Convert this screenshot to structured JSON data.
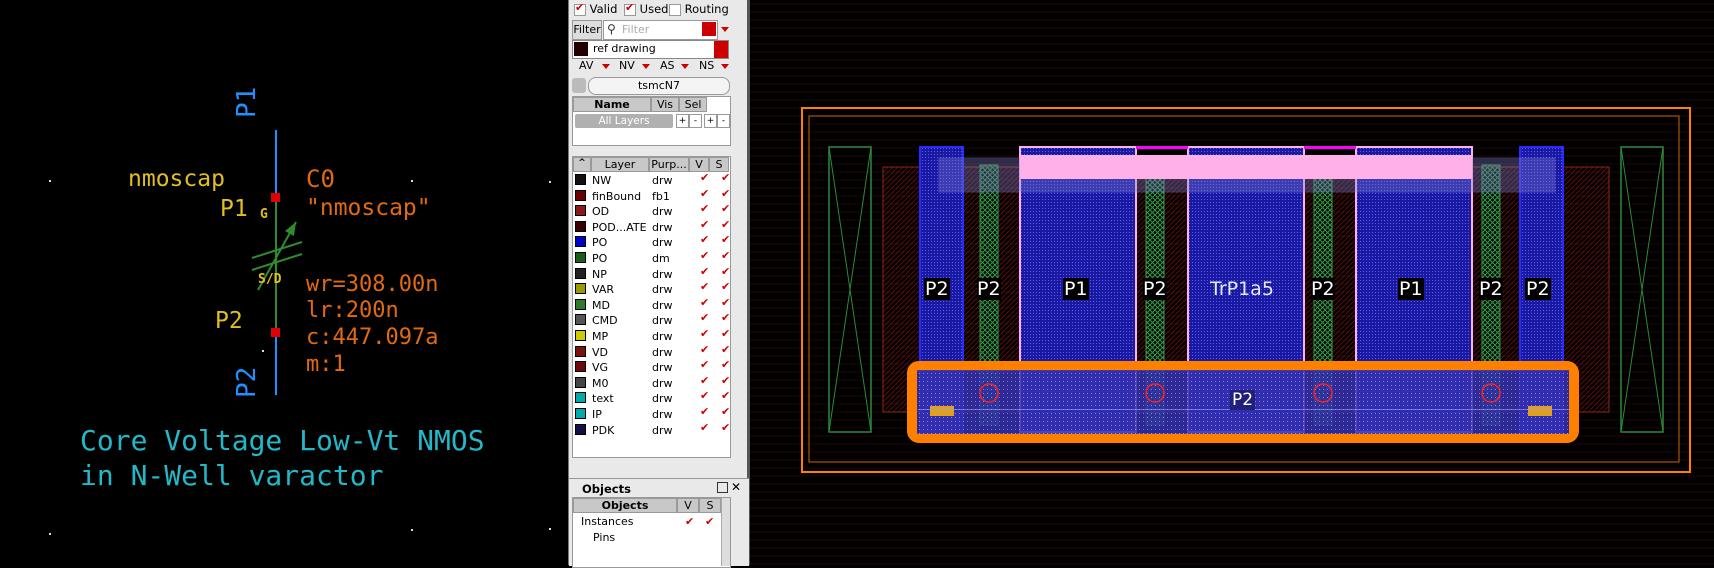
{
  "schematic": {
    "pin_top": "P1",
    "pin_bottom": "P2",
    "cell_name": "nmoscap",
    "inst_name": "C0",
    "cell_quoted": "\"nmoscap\"",
    "net_p1": "P1",
    "net_p2": "P2",
    "gate_label": "G",
    "sd_label": "S/D",
    "params": [
      "wr=308.00n",
      "lr:200n",
      "c:447.097a",
      "m:1"
    ],
    "desc_line1": "Core Voltage Low-Vt NMOS",
    "desc_line2": "in N-Well varactor"
  },
  "panel": {
    "filters": [
      {
        "label": "Valid",
        "checked": true
      },
      {
        "label": "Used",
        "checked": true
      },
      {
        "label": "Routing",
        "checked": false
      }
    ],
    "filter_button": "Filter",
    "filter_placeholder": "Filter",
    "ref_drawing": "ref drawing",
    "toggles": [
      "AV",
      "NV",
      "AS",
      "NS"
    ],
    "tech_lib": "tsmcN7",
    "lpp_headers": {
      "name": "Name",
      "vis": "Vis",
      "sel": "Sel"
    },
    "all_layers": "All Layers",
    "all_layer_buttons": [
      "+",
      "-",
      "+",
      "-"
    ],
    "layer_headers": {
      "layer": "Layer",
      "purpose": "Purp...",
      "v": "V",
      "s": "S"
    },
    "layers": [
      {
        "name": "NW",
        "purpose": "drw",
        "color": "#111111",
        "v": true,
        "s": true
      },
      {
        "name": "finBound",
        "purpose": "fb1",
        "color": "#6b0000",
        "v": true,
        "s": true
      },
      {
        "name": "OD",
        "purpose": "drw",
        "color": "#8b1a1a",
        "v": true,
        "s": true
      },
      {
        "name": "POD...ATE",
        "purpose": "drw",
        "color": "#3a0000",
        "v": true,
        "s": true
      },
      {
        "name": "PO",
        "purpose": "drw",
        "color": "#0000cc",
        "v": true,
        "s": true
      },
      {
        "name": "PO",
        "purpose": "dm",
        "color": "#1a5c1a",
        "v": true,
        "s": true
      },
      {
        "name": "NP",
        "purpose": "drw",
        "color": "#222222",
        "v": true,
        "s": true
      },
      {
        "name": "VAR",
        "purpose": "drw",
        "color": "#999900",
        "v": true,
        "s": true
      },
      {
        "name": "MD",
        "purpose": "drw",
        "color": "#2d7a2d",
        "v": true,
        "s": true
      },
      {
        "name": "CMD",
        "purpose": "drw",
        "color": "#555555",
        "v": true,
        "s": true
      },
      {
        "name": "MP",
        "purpose": "drw",
        "color": "#cccc00",
        "v": true,
        "s": true
      },
      {
        "name": "VD",
        "purpose": "drw",
        "color": "#7a1010",
        "v": true,
        "s": true
      },
      {
        "name": "VG",
        "purpose": "drw",
        "color": "#6a0a0a",
        "v": true,
        "s": true
      },
      {
        "name": "M0",
        "purpose": "drw",
        "color": "#444444",
        "v": true,
        "s": true
      },
      {
        "name": "text",
        "purpose": "drw",
        "color": "#00aaaa",
        "v": true,
        "s": true
      },
      {
        "name": "IP",
        "purpose": "drw",
        "color": "#00aaaa",
        "v": true,
        "s": true
      },
      {
        "name": "PDK",
        "purpose": "drw",
        "color": "#111144",
        "v": true,
        "s": true
      }
    ],
    "objects_title": "Objects",
    "objects_headers": {
      "objects": "Objects",
      "v": "V",
      "s": "S"
    },
    "objects_rows": [
      {
        "name": "Instances",
        "v": true,
        "s": true
      },
      {
        "name": "Pins",
        "v": true,
        "s": true
      }
    ]
  },
  "layout": {
    "labels_p2": "P2",
    "labels_p1": "P1",
    "label_small": "P2",
    "center_text": "TrP1a5",
    "center_text_b": "P1",
    "bottom_label": "P2"
  },
  "colors": {
    "schematic_pin": "#1e90ff",
    "schematic_green": "#2e8b2e",
    "schematic_yellow": "#e0c020",
    "schematic_orange": "#e06a10",
    "schematic_text_cyan": "#22b8c8",
    "panel_accent": "#c00000",
    "layout_orange": "#ff8000",
    "layout_pink": "#ffb0e8"
  }
}
